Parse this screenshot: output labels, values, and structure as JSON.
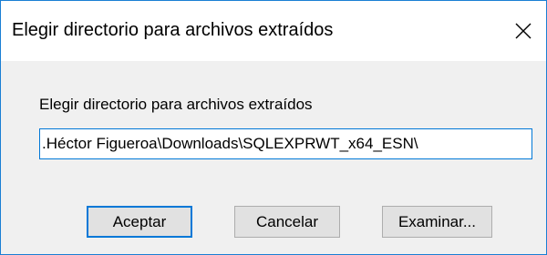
{
  "dialog": {
    "title": "Elegir directorio para archivos extraídos",
    "close_icon": "close-icon",
    "field_label": "Elegir directorio para archivos extraídos",
    "path_value": ".Héctor Figueroa\\Downloads\\SQLEXPRWT_x64_ESN\\",
    "buttons": {
      "ok": "Aceptar",
      "cancel": "Cancelar",
      "browse": "Examinar..."
    }
  },
  "colors": {
    "accent": "#0078d7",
    "window_border": "#1a7fd4",
    "button_face": "#e1e1e1",
    "dialog_background": "#f0f0f0"
  }
}
